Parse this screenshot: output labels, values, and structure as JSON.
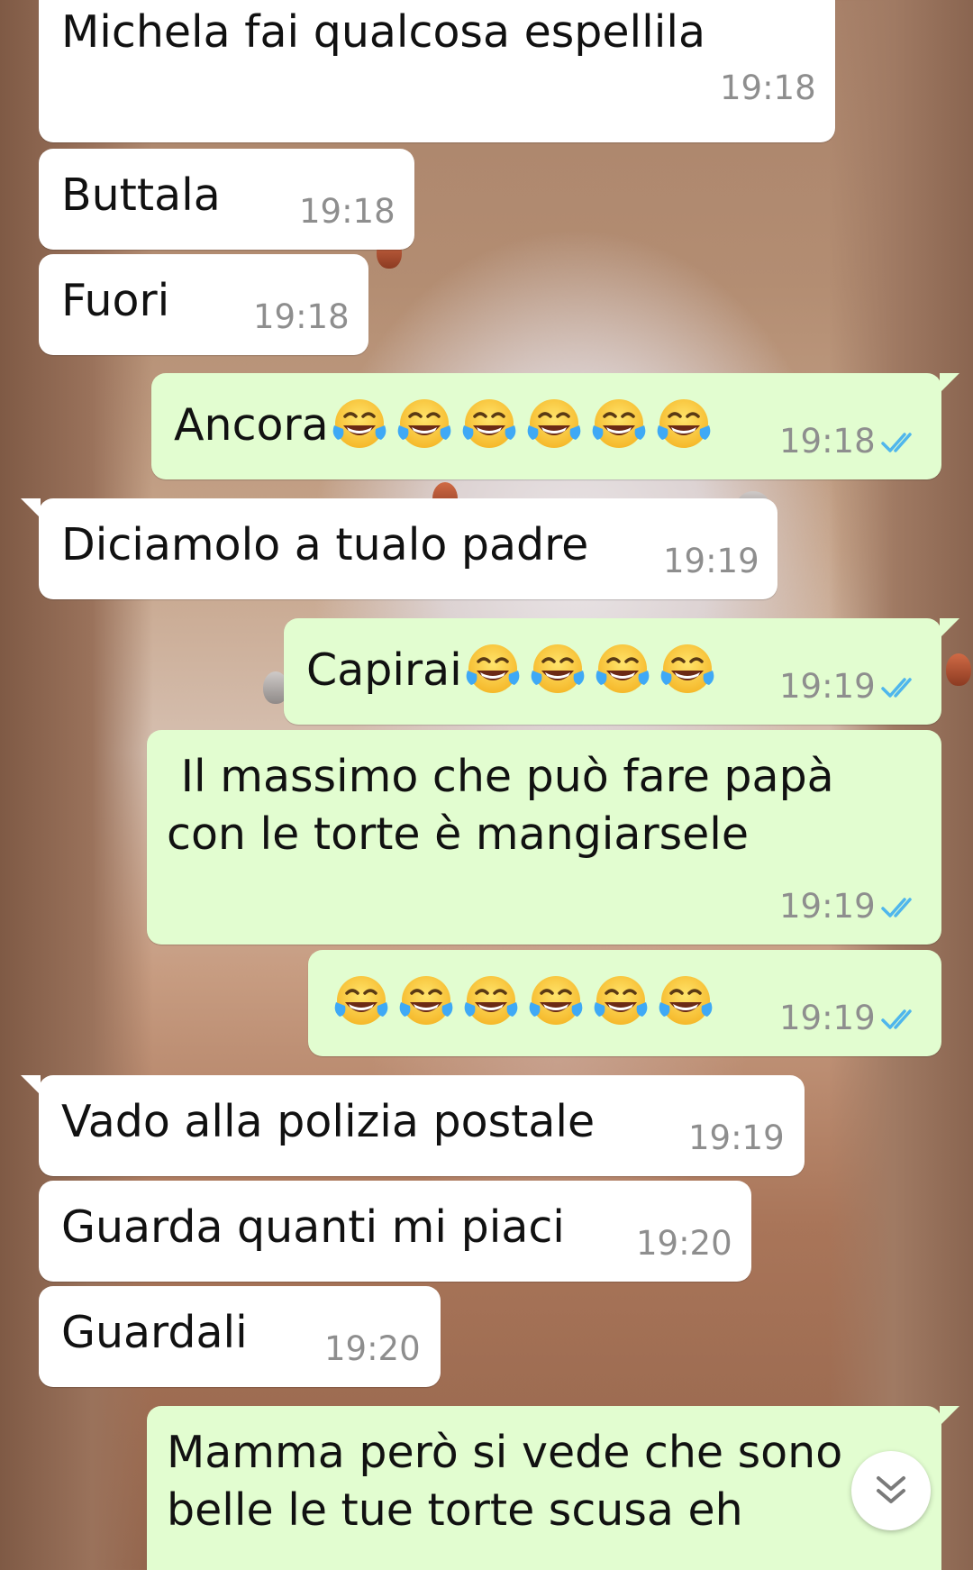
{
  "colors": {
    "incoming_bubble": "#ffffff",
    "outgoing_bubble": "#e2fdd0",
    "timestamp": "#8e8e8e",
    "read_ticks": "#4fb6ec"
  },
  "messages": [
    {
      "direction": "in",
      "text": "Michela fai qualcosa espellila",
      "time": "19:18"
    },
    {
      "direction": "in",
      "text": "Buttala",
      "time": "19:18"
    },
    {
      "direction": "in",
      "text": "Fuori",
      "time": "19:18"
    },
    {
      "direction": "out",
      "text": "Ancora",
      "emoji_count": 6,
      "emoji": "face-with-tears-of-joy",
      "time": "19:18",
      "status": "read"
    },
    {
      "direction": "in",
      "text": "Diciamolo a tualo padre",
      "time": "19:19"
    },
    {
      "direction": "out",
      "text": "Capirai",
      "emoji_count": 4,
      "emoji": "face-with-tears-of-joy",
      "time": "19:19",
      "status": "read"
    },
    {
      "direction": "out",
      "text_line1": " Il massimo che può fare papà",
      "text_line2": "con le torte è mangiarsele",
      "time": "19:19",
      "status": "read"
    },
    {
      "direction": "out",
      "text": "",
      "emoji_count": 6,
      "emoji": "face-with-tears-of-joy",
      "time": "19:19",
      "status": "read"
    },
    {
      "direction": "in",
      "text": "Vado alla polizia postale",
      "time": "19:19"
    },
    {
      "direction": "in",
      "text": "Guarda quanti mi piaci",
      "time": "19:20"
    },
    {
      "direction": "in",
      "text": "Guardali",
      "time": "19:20"
    },
    {
      "direction": "out",
      "text_line1": "Mamma però si vede che sono",
      "text_line2": "belle le tue torte scusa eh",
      "time": "",
      "status": ""
    }
  ],
  "scroll_button": {
    "icon": "double-chevron-down-icon"
  }
}
